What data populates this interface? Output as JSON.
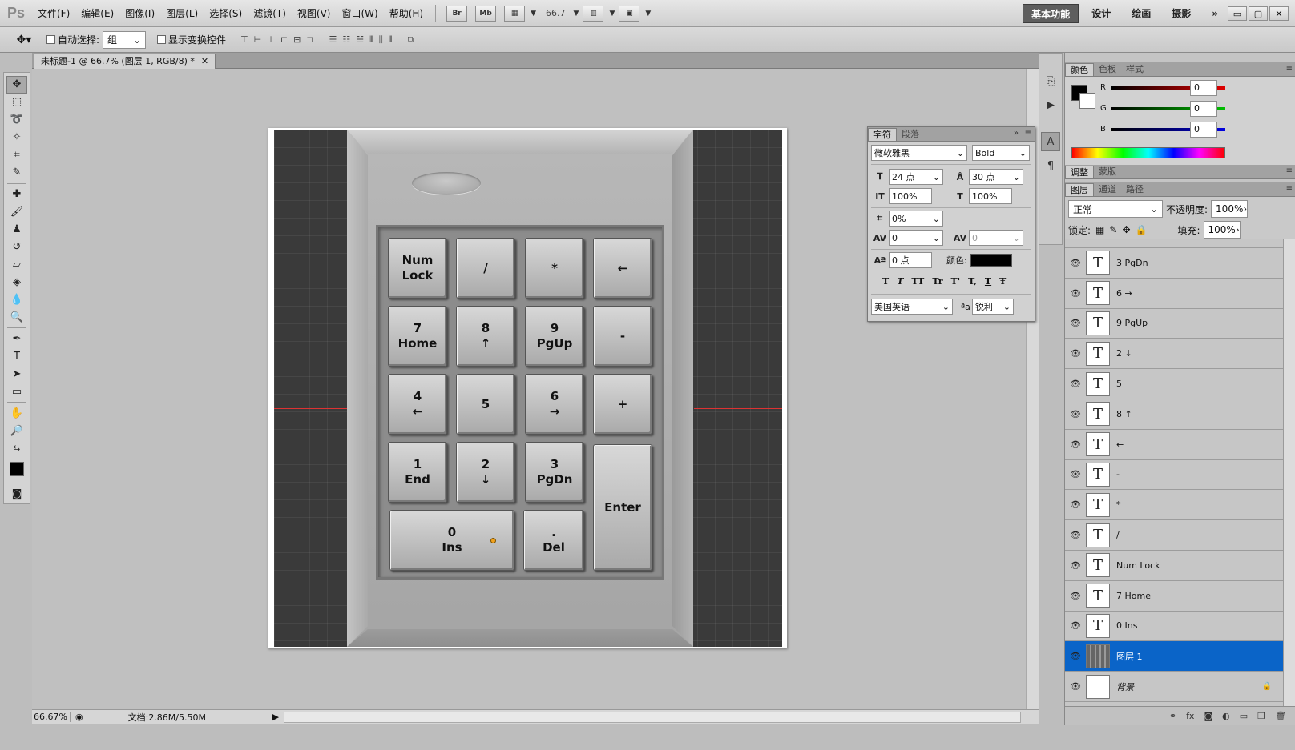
{
  "app": {
    "logo": "Ps"
  },
  "menu": [
    "文件(F)",
    "编辑(E)",
    "图像(I)",
    "图层(L)",
    "选择(S)",
    "滤镜(T)",
    "视图(V)",
    "窗口(W)",
    "帮助(H)"
  ],
  "menubar_buttons": {
    "bridge": "Br",
    "minibridge": "Mb",
    "zoom": "66.7"
  },
  "workspaces": {
    "active": "基本功能",
    "items": [
      "设计",
      "绘画",
      "摄影"
    ],
    "more": "»"
  },
  "window_controls": {
    "minimize": "▭",
    "restore": "▢",
    "close": "✕"
  },
  "options_bar": {
    "auto_select_label": "自动选择:",
    "auto_select_value": "组",
    "show_transform_label": "显示变换控件"
  },
  "document": {
    "tab_title": "未标题-1 @ 66.7% (图层 1, RGB/8) *",
    "tab_close": "✕",
    "zoom_status": "66.67%",
    "doc_status": "文档:2.86M/5.50M"
  },
  "keypad_keys": [
    {
      "label": "Num\nLock"
    },
    {
      "label": "/"
    },
    {
      "label": "*"
    },
    {
      "label": "←"
    },
    {
      "label": "7\nHome"
    },
    {
      "label": "8\n↑"
    },
    {
      "label": "9\nPgUp"
    },
    {
      "label": "-"
    },
    {
      "label": "4\n←"
    },
    {
      "label": "5"
    },
    {
      "label": "6\n→"
    },
    {
      "label": "+"
    },
    {
      "label": "1\nEnd"
    },
    {
      "label": "2\n↓"
    },
    {
      "label": "3\nPgDn"
    },
    {
      "label": "Enter"
    },
    {
      "label": "0\nIns"
    },
    {
      "label": ".\nDel"
    }
  ],
  "color_panel": {
    "tabs": [
      "颜色",
      "色板",
      "样式"
    ],
    "channels": [
      {
        "name": "R",
        "value": "0",
        "color": "#e00000"
      },
      {
        "name": "G",
        "value": "0",
        "color": "#00c000"
      },
      {
        "name": "B",
        "value": "0",
        "color": "#0000e0"
      }
    ]
  },
  "char_panel": {
    "tabs": [
      "字符",
      "段落"
    ],
    "font_family": "微软雅黑",
    "font_style": "Bold",
    "font_size": "24 点",
    "leading": "30 点",
    "vertical_scale": "100%",
    "horizontal_scale": "100%",
    "tracking_pct": "0%",
    "kerning": "0",
    "tracking": "0",
    "baseline_shift": "0 点",
    "color_label": "颜色:",
    "language": "美国英语",
    "aa_label": "ªa",
    "antialias": "锐利",
    "style_buttons": [
      "T",
      "T",
      "TT",
      "Tr",
      "T'",
      "T,",
      "T",
      "Ŧ"
    ]
  },
  "adj_tabs": [
    "调整",
    "蒙版"
  ],
  "layers_panel": {
    "tabs": [
      "图层",
      "通道",
      "路径"
    ],
    "blend_mode": "正常",
    "opacity_label": "不透明度:",
    "opacity": "100%",
    "lock_label": "锁定:",
    "fill_label": "填充:",
    "fill": "100%",
    "layers": [
      {
        "name": "3 PgDn",
        "type": "text"
      },
      {
        "name": "6 →",
        "type": "text"
      },
      {
        "name": "9 PgUp",
        "type": "text"
      },
      {
        "name": "2 ↓",
        "type": "text"
      },
      {
        "name": "5",
        "type": "text"
      },
      {
        "name": "8 ↑",
        "type": "text"
      },
      {
        "name": "←",
        "type": "text"
      },
      {
        "name": "-",
        "type": "text"
      },
      {
        "name": "*",
        "type": "text"
      },
      {
        "name": "/",
        "type": "text"
      },
      {
        "name": "Num Lock",
        "type": "text"
      },
      {
        "name": "7 Home",
        "type": "text"
      },
      {
        "name": "0 Ins",
        "type": "text"
      },
      {
        "name": "图层 1",
        "type": "image",
        "selected": true
      },
      {
        "name": "背景",
        "type": "background",
        "locked": true
      }
    ],
    "footer_icons": [
      "⚭",
      "fx",
      "◙",
      "◐",
      "▭",
      "❐",
      "🗑"
    ]
  },
  "colors": {
    "selection": "#0a64c8",
    "accent_orange": "#f2a11c",
    "guide": "#dd3333"
  }
}
